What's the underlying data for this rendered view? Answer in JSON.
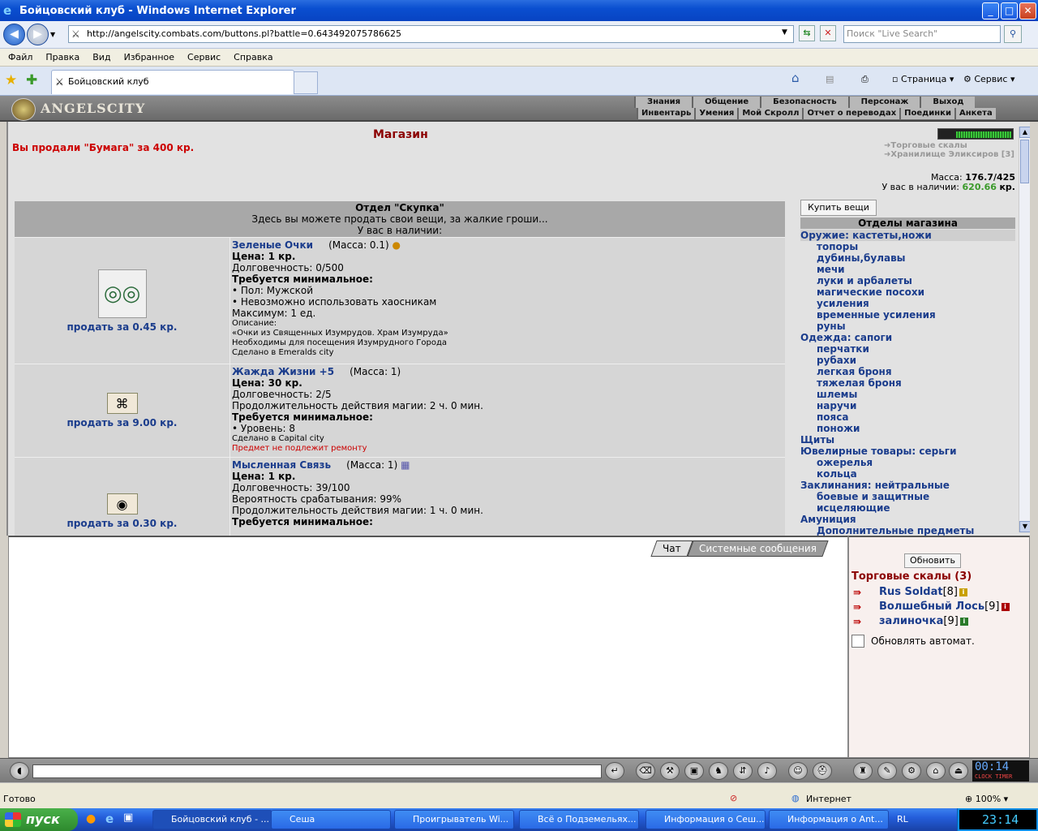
{
  "window": {
    "title": "Бойцовский клуб - Windows Internet Explorer",
    "min": "_",
    "max": "□",
    "close": "✕"
  },
  "browser": {
    "url": "http://angelscity.combats.com/buttons.pl?battle=0.643492075786625",
    "search_placeholder": "Поиск \"Live Search\"",
    "menu": [
      "Файл",
      "Правка",
      "Вид",
      "Избранное",
      "Сервис",
      "Справка"
    ],
    "tab_title": "Бойцовский клуб",
    "cmd_page": "Страница",
    "cmd_service": "Сервис"
  },
  "game": {
    "logo": "ANGELSCITY",
    "nav_top": [
      "Знания",
      "Общение",
      "Безопасность",
      "Персонаж",
      "Выход"
    ],
    "nav_bottom": [
      "Инвентарь",
      "Умения",
      "Мой Скролл",
      "Отчет о переводах",
      "Поединки",
      "Анкета"
    ]
  },
  "shop": {
    "title": "Магазин",
    "sold_message": "Вы продали \"Бумага\" за 400 кр.",
    "links": [
      "Торговые скалы",
      "Хранилище Эликсиров [3]"
    ],
    "mass_label": "Масса:",
    "mass_value": "176.7/425",
    "money_label": "У вас в наличии:",
    "money_value": "620.66",
    "money_unit": "кр.",
    "dept_title": "Отдел \"Скупка\"",
    "dept_desc": "Здесь вы можете продать свои вещи, за жалкие гроши...",
    "dept_have": "У вас в наличии:",
    "buy_button": "Купить вещи",
    "dept_list_title": "Отделы магазина"
  },
  "items": [
    {
      "name": "Зеленые Очки",
      "mass": "(Масса: 0.1)",
      "price": "Цена: 1 кр.",
      "durability": "Долговечность: 0/500",
      "req_title": "Требуется минимальное:",
      "req1": "• Пол: Мужской",
      "req2": "• Невозможно использовать хаосникам",
      "max": "Максимум: 1 ед.",
      "desc_label": "Описание:",
      "desc1": "«Очки из Священных Изумрудов. Храм Изумруда»",
      "desc2": "Необходимы для посещения Изумрудного Города",
      "made": "Сделано в Emeralds city",
      "sell": "продать за 0.45 кр."
    },
    {
      "name": "Жажда Жизни +5",
      "mass": "(Масса: 1)",
      "price": "Цена: 30 кр.",
      "durability": "Долговечность: 2/5",
      "duration": "Продолжительность действия магии: 2 ч. 0 мин.",
      "req_title": "Требуется минимальное:",
      "req1": "• Уровень: 8",
      "made": "Сделано в Capital city",
      "norepair": "Предмет не подлежит ремонту",
      "sell": "продать за 9.00 кр."
    },
    {
      "name": "Мысленная Связь",
      "mass": "(Масса: 1)",
      "price": "Цена: 1 кр.",
      "durability": "Долговечность: 39/100",
      "chance": "Вероятность срабатывания: 99%",
      "duration": "Продолжительность действия магии: 1 ч. 0 мин.",
      "req_title": "Требуется минимальное:",
      "sell": "продать за 0.30 кр."
    }
  ],
  "departments": [
    {
      "label": "Оружие: кастеты,ножи",
      "sub": false,
      "selected": true
    },
    {
      "label": "топоры",
      "sub": true
    },
    {
      "label": "дубины,булавы",
      "sub": true
    },
    {
      "label": "мечи",
      "sub": true
    },
    {
      "label": "луки и арбалеты",
      "sub": true
    },
    {
      "label": "магические посохи",
      "sub": true
    },
    {
      "label": "усиления",
      "sub": true
    },
    {
      "label": "временные усиления",
      "sub": true
    },
    {
      "label": "руны",
      "sub": true
    },
    {
      "label": "Одежда: сапоги",
      "sub": false
    },
    {
      "label": "перчатки",
      "sub": true
    },
    {
      "label": "рубахи",
      "sub": true
    },
    {
      "label": "легкая броня",
      "sub": true
    },
    {
      "label": "тяжелая броня",
      "sub": true
    },
    {
      "label": "шлемы",
      "sub": true
    },
    {
      "label": "наручи",
      "sub": true
    },
    {
      "label": "пояса",
      "sub": true
    },
    {
      "label": "поножи",
      "sub": true
    },
    {
      "label": "Щиты",
      "sub": false
    },
    {
      "label": "Ювелирные товары: серьги",
      "sub": false
    },
    {
      "label": "ожерелья",
      "sub": true
    },
    {
      "label": "кольца",
      "sub": true
    },
    {
      "label": "Заклинания: нейтральные",
      "sub": false
    },
    {
      "label": "боевые и защитные",
      "sub": true
    },
    {
      "label": "исцеляющие",
      "sub": true
    },
    {
      "label": "Амуниция",
      "sub": false
    },
    {
      "label": "Дополнительные предметы",
      "sub": true
    }
  ],
  "chat": {
    "tab_chat": "Чат",
    "tab_system": "Системные сообщения"
  },
  "online": {
    "refresh": "Обновить",
    "title": "Торговые скалы (3)",
    "users": [
      {
        "name": "Rus Soldat",
        "level": "[8]",
        "info": "i"
      },
      {
        "name": "Волшебный Лось",
        "level": "[9]",
        "info": "i"
      },
      {
        "name": "залиночка",
        "level": "[9]",
        "info": "i"
      }
    ],
    "auto_refresh": "Обновлять автомат."
  },
  "game_clock": {
    "time": "00:14",
    "clock_label": "CLOCK",
    "timer_label": "TIMER"
  },
  "status": {
    "text": "Готово",
    "zone": "Интернет",
    "zoom": "100%"
  },
  "taskbar": {
    "start": "пуск",
    "tasks": [
      "Бойцовский клуб - ...",
      "Сеша",
      "Проигрыватель Wi...",
      "Всё о Подземельях...",
      "Информация о Сеш...",
      "Информация о Ant..."
    ],
    "lang": "RL",
    "time": "23:14"
  }
}
